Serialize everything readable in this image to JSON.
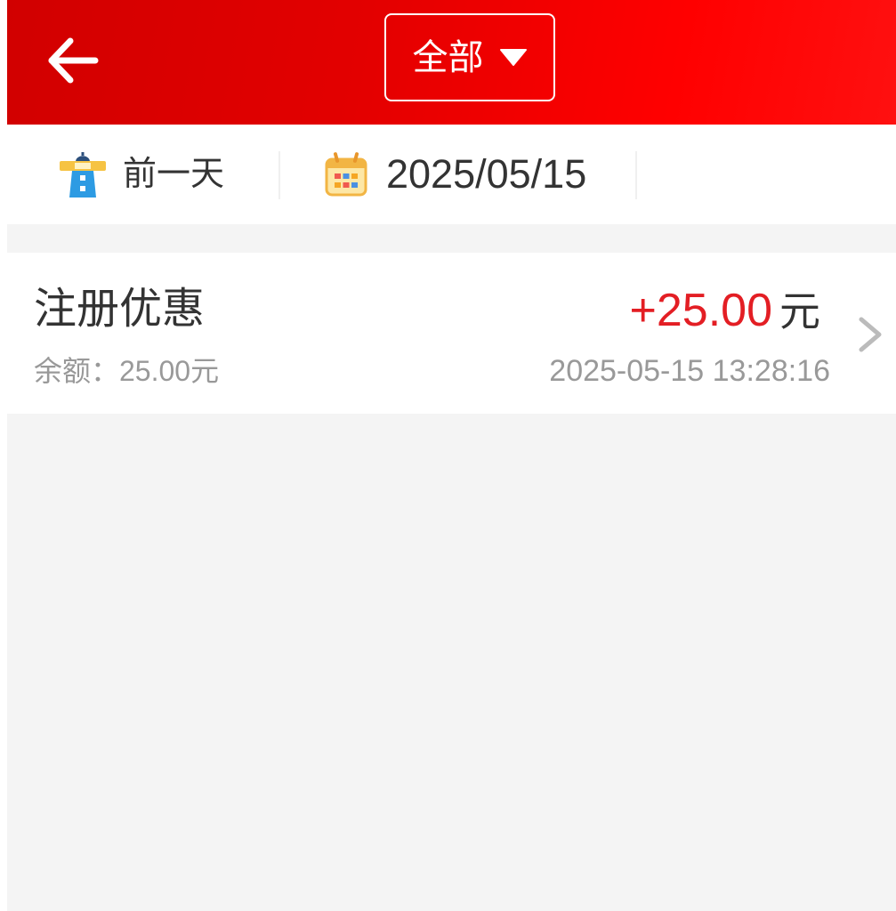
{
  "header": {
    "back_icon": "arrow-left-icon",
    "filter": {
      "label": "全部",
      "icon": "caret-down-icon"
    }
  },
  "date_bar": {
    "prev_day": {
      "label": "前一天",
      "icon": "lighthouse-icon"
    },
    "date_picker": {
      "value": "2025/05/15",
      "icon": "calendar-icon"
    }
  },
  "records": [
    {
      "title": "注册优惠",
      "balance": "余额：25.00元",
      "amount": "+25.00",
      "amount_unit": "元",
      "time": "2025-05-15 13:28:16",
      "icon": "chevron-right-icon"
    }
  ],
  "colors": {
    "header_red": "#e30000",
    "amount_red": "#e31e24",
    "text_primary": "#333333",
    "text_secondary": "#999999",
    "page_background": "#f4f4f4"
  }
}
